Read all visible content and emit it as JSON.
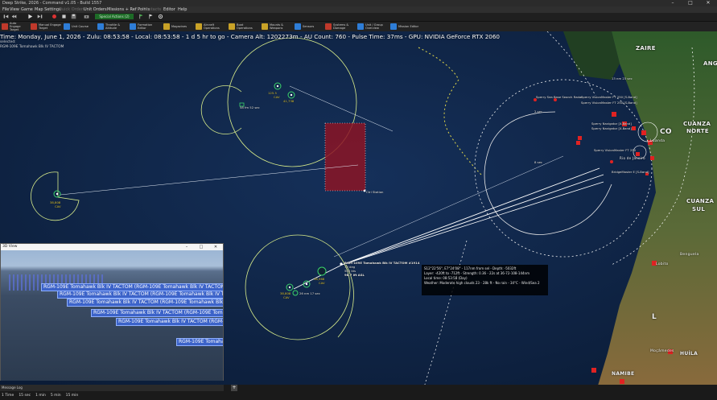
{
  "window": {
    "title": "Deep Strike, 2026 - Command v1.05 - Build 1557",
    "controls": [
      "–",
      "□",
      "✕"
    ]
  },
  "menu": [
    "File",
    "View",
    "Game",
    "Map Settings",
    "Quick Orders",
    "Unit Orders",
    "Missions + Ref Points",
    "Contacts",
    "Editor",
    "Help"
  ],
  "toolbar1": {
    "special_label": "Special Actions (2)"
  },
  "toolbar2": [
    {
      "label": "Auto Engage Target",
      "color": "#c0392b"
    },
    {
      "label": "Manual Engage Target",
      "color": "#c0392b"
    },
    {
      "label": "Unit Course",
      "color": "#2e7dd7"
    },
    {
      "label": "Throttle & Altitude",
      "color": "#2e7dd7"
    },
    {
      "label": "Formation Editor",
      "color": "#2e7dd7"
    },
    {
      "label": "Magazines",
      "color": "#c9a227"
    },
    {
      "label": "Aircraft Operations",
      "color": "#c9a227"
    },
    {
      "label": "Boat Operations",
      "color": "#c9a227"
    },
    {
      "label": "Mounts & Weapons",
      "color": "#c9a227"
    },
    {
      "label": "Sensors",
      "color": "#2e7dd7"
    },
    {
      "label": "Systems & Damage",
      "color": "#c0392b"
    },
    {
      "label": "Unit / Group Overview",
      "color": "#2e7dd7"
    },
    {
      "label": "Mission Editor",
      "color": "#2e7dd7"
    }
  ],
  "status": {
    "line": "Time: Monday, June 1, 2026 - Zulu: 08:53:58 - Local: 08:53:58 - 1 d 5 hr to go -  Camera Alt: 1202273m  - AU Count: 760 - Pulse Time: 37ms - GPU: NVIDIA GeForce RTX 2060",
    "sub1": "selected:",
    "sub2": "RGM-109E Tomahawk Blk IV TACTOM"
  },
  "map_labels": {
    "ctrl_station": "Ctrl Station",
    "aircraft_top1": "125.5",
    "aircraft_top1b": "CAV",
    "aircraft_top2": "41,738",
    "range_top": "58 fm  52 sec",
    "aircraft_left": "CAV",
    "aircraft_left_alt": "38,808",
    "missile_label": "RGM-109E Tomahawk Blk IV TACTOM #1914",
    "missile_sub1": "79 deg",
    "missile_sub2": "560 kts",
    "missile_sub3": "96.7 lft ASL",
    "group_alt1": "38,968",
    "group_cav1": "CAV",
    "group_alt2": "38,808",
    "group_cav2": "CAV",
    "group_time": "26 nm  17 sec",
    "sperry1": "Sperry VisionMaster FT 250 [S-Band]",
    "sperry2": "Sperry VisionMaster FT 250 [S-Band]",
    "sperry3": "Sperry Navigator [X-Band]",
    "sperry4": "Sperry Navigator [X-Band]",
    "sperry5": "Sperry VisionMaster FT 250",
    "bridgemaster": "BridgeMaster E [S-Band]",
    "sea_sparrow": "Sperry Sea Base Search Radar",
    "time2": "2 sec",
    "time8": "8 sec",
    "zaire_marker": "13 nm  23 sec"
  },
  "places": {
    "zaire": "ZAIRE",
    "cuanza_norte1": "CUANZA",
    "cuanza_norte2": "NORTE",
    "cuanza_sul1": "CUANZA",
    "cuanza_sul2": "SUL",
    "luanda": "Luanda",
    "namibe": "NAMIBE",
    "huila": "HUÍLA",
    "benguela": "Benguela",
    "mocamedes": "Moçâmedes",
    "lobito": "Lobito",
    "rio_de_janeiro": "Rio de Janeiro",
    "ang": "ANG",
    "co": "CO",
    "l": "L"
  },
  "infobox": {
    "line1": "S12°22'56\", E7°24'08\" - 117nm from sel - Depth: -5032ft",
    "line2": "Layer: -420ft to -712ft - Strength: 0.36 - 22s at 36-72-108-144nm",
    "line3": "Local time: 08:53:58 (Day)",
    "line4": "Weather: Moderate high clouds 23 - 28k ft - No rain - 34°C - Wind/Sea 2"
  },
  "view3d": {
    "title": "3D View",
    "labels": [
      "RGM-109E Tomahawk Blk IV TACTOM (RGM-109E Tomahawk Blk IV TACTOM",
      "RGM-109E Tomahawk Blk IV TACTOM (RGM-109E Tomahawk Blk IV TACTOM",
      "RGM-109E Tomahawk Blk IV TACTOM (RGM-109E Tomahawk Blk IV TACTOM",
      "RGM-109E Tomahawk Blk IV TACTOM (RGM-109E Tomahawk Blk IV TACTOM",
      "RGM-109E Tomahawk Blk IV TACTOM (RGM-109E Tomahawk Blk IV TACTOM",
      "RGM-109E Tomahawk"
    ]
  },
  "bottom": {
    "message_log": "Message Log",
    "time_compression": [
      "1 Time",
      "15 sec",
      "1 min",
      "5 min",
      "15 min"
    ]
  },
  "colors": {
    "range_ring": "#d8ec8a",
    "missile_line": "#e6eef7",
    "target_box": "#8b1424",
    "hostile": "#e02222",
    "friendly_green": "#3ad36a"
  }
}
